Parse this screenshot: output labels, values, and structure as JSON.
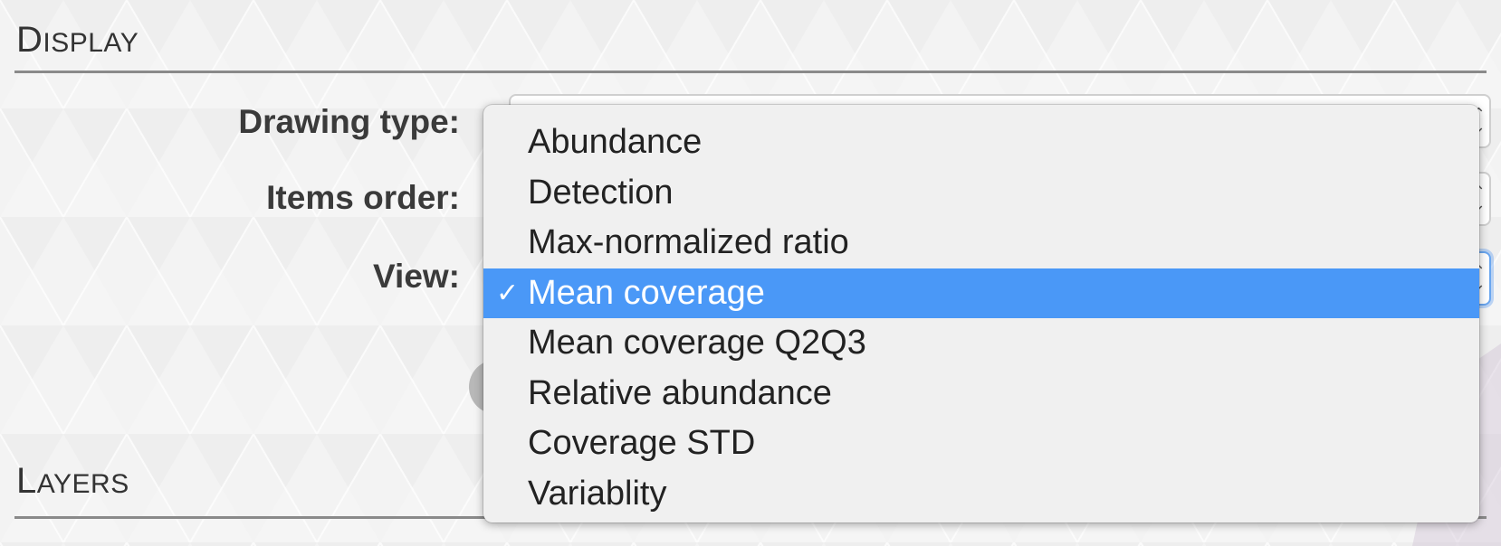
{
  "display_section": {
    "title_initial": "D",
    "title_rest": "ISPLAY"
  },
  "layers_section": {
    "title_initial": "L",
    "title_rest": "AYERS"
  },
  "form": {
    "drawing_type_label": "Drawing type:",
    "items_order_label": "Items order:",
    "view_label": "View:"
  },
  "view_dropdown": {
    "selected_value": "Mean coverage",
    "check_glyph": "✓",
    "options": [
      "Abundance",
      "Detection",
      "Max-normalized ratio",
      "Mean coverage",
      "Mean coverage Q2Q3",
      "Relative abundance",
      "Coverage STD",
      "Variablity"
    ]
  },
  "icons": {
    "select_arrows": "updown-chevron-icon",
    "check": "checkmark-icon"
  },
  "colors": {
    "selection_highlight": "#4a98f7",
    "focus_ring": "#6aa6ef",
    "section_rule": "#8a8a8a"
  }
}
